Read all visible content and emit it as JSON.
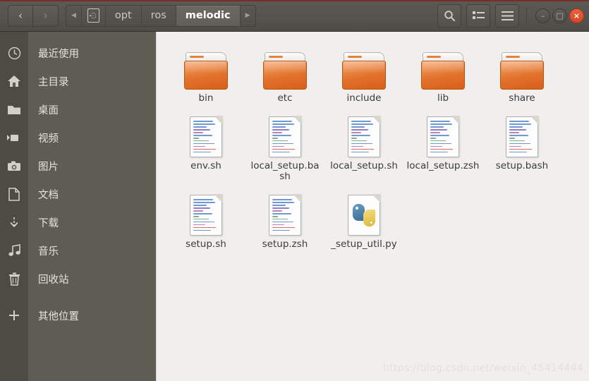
{
  "window": {
    "titlebar": {
      "back_label": "‹",
      "forward_label": "›",
      "prev_crumb_arrow": "◀",
      "next_crumb_arrow": "▶",
      "breadcrumbs": [
        {
          "label": "opt",
          "active": false
        },
        {
          "label": "ros",
          "active": false
        },
        {
          "label": "melodic",
          "active": true
        }
      ],
      "root_icon": "hard-drive-icon",
      "tools": [
        {
          "name": "search-icon",
          "label": ""
        },
        {
          "name": "view-list-icon",
          "label": ""
        },
        {
          "name": "hamburger-menu-icon",
          "label": ""
        }
      ],
      "window_controls": {
        "minimize": "–",
        "maximize": "□",
        "close": "×"
      }
    }
  },
  "sidebar": {
    "items": [
      {
        "label": "最近使用",
        "icon": "clock-icon"
      },
      {
        "label": "主目录",
        "icon": "home-icon"
      },
      {
        "label": "桌面",
        "icon": "folder-icon"
      },
      {
        "label": "视频",
        "icon": "video-camera-icon"
      },
      {
        "label": "图片",
        "icon": "camera-icon"
      },
      {
        "label": "文档",
        "icon": "document-icon"
      },
      {
        "label": "下载",
        "icon": "download-icon"
      },
      {
        "label": "音乐",
        "icon": "music-note-icon"
      },
      {
        "label": "回收站",
        "icon": "trash-icon"
      },
      {
        "label": "其他位置",
        "icon": "plus-icon"
      }
    ]
  },
  "files": [
    {
      "name": "bin",
      "type": "folder"
    },
    {
      "name": "etc",
      "type": "folder"
    },
    {
      "name": "include",
      "type": "folder"
    },
    {
      "name": "lib",
      "type": "folder"
    },
    {
      "name": "share",
      "type": "folder"
    },
    {
      "name": "env.sh",
      "type": "script"
    },
    {
      "name": "local_setup.bash",
      "type": "script"
    },
    {
      "name": "local_setup.sh",
      "type": "script"
    },
    {
      "name": "local_setup.zsh",
      "type": "script"
    },
    {
      "name": "setup.bash",
      "type": "script"
    },
    {
      "name": "setup.sh",
      "type": "script"
    },
    {
      "name": "setup.zsh",
      "type": "script"
    },
    {
      "name": "_setup_util.py",
      "type": "python"
    }
  ],
  "watermark": "https://blog.csdn.net/weixin_45414444",
  "colors": {
    "titlebar": "#56544e",
    "sidebar_rail": "#4c4c45",
    "sidebar_panel": "#5e5d53",
    "content_bg": "#f0efee",
    "folder_orange": "#e2712c",
    "close_button": "#d8452a",
    "accent_top": "#7d2a2a"
  }
}
